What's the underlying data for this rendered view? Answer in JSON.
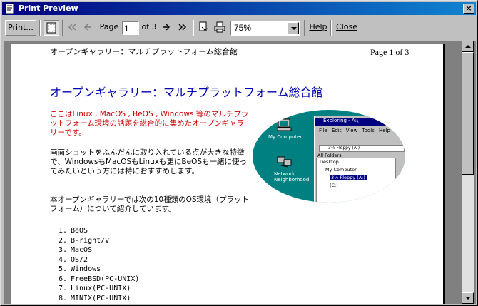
{
  "window": {
    "title": "Print Preview",
    "close_glyph": "×"
  },
  "toolbar": {
    "print_label": "Print...",
    "page_label": "Page",
    "page_value": "1",
    "of_label": "of 3",
    "zoom_value": "75%",
    "help_label": "Help",
    "close_label": "Close",
    "icons": [
      "one-page-icon",
      "first-page-icon",
      "prev-page-icon",
      "next-page-icon",
      "last-page-icon",
      "page-setup-icon",
      "print-icon"
    ]
  },
  "page": {
    "header_left": "オープンギャラリー：マルチプラットフォーム総合館",
    "header_right": "Page 1 of 3",
    "heading": "オープンギャラリー：マルチプラットフォーム総合館",
    "intro": "ここはLinux , MacOS , BeOS , Windows 等のマルチプラットフォーム環境の話題を総合的に集めたオープンギャラリーです。",
    "para1": "画面ショットをふんだんに取り入れている点が大きな特徴で、WindowsもMacOSもLinuxも更にBeOSも一緒に使ってみたいという方には特におすすめします。",
    "para2": "本オープンギャラリーでは次の10種類のOS環境（プラットフォーム）について紹介しています。",
    "os_list": [
      {
        "num": "1.",
        "name": "BeOS"
      },
      {
        "num": "2.",
        "name": "B-right/V"
      },
      {
        "num": "3.",
        "name": "MacOS"
      },
      {
        "num": "4.",
        "name": "OS/2"
      },
      {
        "num": "5.",
        "name": "Windows"
      },
      {
        "num": "6.",
        "name": "FreeBSD(PC-UNIX)"
      },
      {
        "num": "7.",
        "name": "Linux(PC-UNIX)"
      },
      {
        "num": "8.",
        "name": "MINIX(PC-UNIX)"
      }
    ],
    "screenshot": {
      "my_computer": "My Computer",
      "network": "Network Neighborhood",
      "win_title": "Exploring - A:\\",
      "menu": "File Edit View Tools Help",
      "address": "3½ Floppy (A:)",
      "all_folders": "All Folders",
      "desktop": "Desktop",
      "tree_mycomp": "My Computer",
      "tree_floppy": "3½ Floppy (A:)",
      "tree_c": "(C:)"
    }
  },
  "colors": {
    "title_start": "#000080",
    "title_end": "#1084d0",
    "heading": "#0000b0",
    "intro": "#cc0000"
  }
}
